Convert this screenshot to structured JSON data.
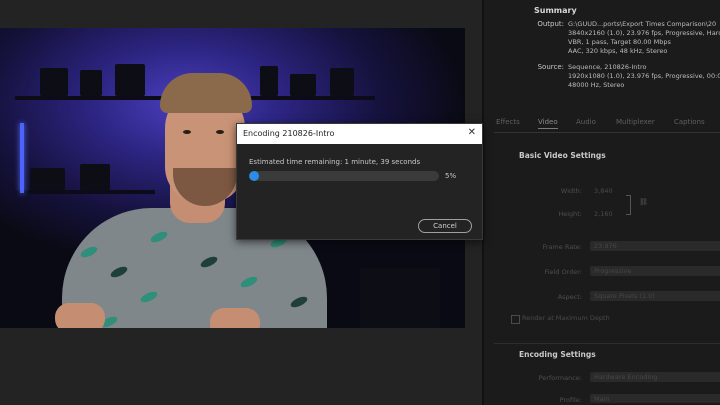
{
  "dialog": {
    "title": "Encoding 210826-Intro",
    "close_glyph": "✕",
    "eta_text": "Estimated time remaining: 1 minute, 39 seconds",
    "progress_fraction": 0.05,
    "progress_label": "5%",
    "cancel_label": "Cancel",
    "accent_color": "#2d8ceb"
  },
  "summary": {
    "title": "Summary",
    "output_label": "Output:",
    "output_lines": [
      "G:\\GUUD...ports\\Export Times Comparison\\20",
      "3840x2160 (1.0), 23.976 fps, Progressive, Hardw",
      "VBR, 1 pass, Target 80.00 Mbps",
      "AAC, 320 kbps, 48 kHz, Stereo"
    ],
    "source_label": "Source:",
    "source_lines": [
      "Sequence, 210826-Intro",
      "1920x1080 (1.0), 23.976 fps, Progressive, 00:01",
      "48000 Hz, Stereo"
    ]
  },
  "tabs": [
    "Effects",
    "Video",
    "Audio",
    "Multiplexer",
    "Captions"
  ],
  "basic_video": {
    "title": "Basic Video Settings",
    "width_label": "Width:",
    "width_value": "3,840",
    "height_label": "Height:",
    "height_value": "2,160",
    "frame_rate_label": "Frame Rate:",
    "frame_rate_value": "23.976",
    "field_order_label": "Field Order:",
    "field_order_value": "Progressive",
    "aspect_label": "Aspect:",
    "aspect_value": "Square Pixels (1.0)",
    "render_max_label": "Render at Maximum Depth"
  },
  "encoding": {
    "title": "Encoding Settings",
    "performance_label": "Performance:",
    "performance_value": "Hardware Encoding",
    "profile_label": "Profile:",
    "profile_value": "Main"
  }
}
